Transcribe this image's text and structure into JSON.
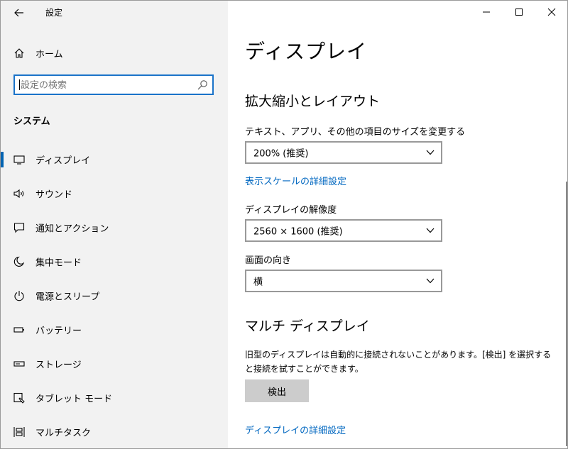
{
  "window": {
    "title": "設定"
  },
  "sidebar": {
    "home_label": "ホーム",
    "search": {
      "placeholder": "設定の検索",
      "value": ""
    },
    "section_title": "システム",
    "items": [
      {
        "label": "ディスプレイ",
        "icon": "monitor-icon",
        "selected": true
      },
      {
        "label": "サウンド",
        "icon": "speaker-icon"
      },
      {
        "label": "通知とアクション",
        "icon": "message-icon"
      },
      {
        "label": "集中モード",
        "icon": "moon-icon"
      },
      {
        "label": "電源とスリープ",
        "icon": "power-icon"
      },
      {
        "label": "バッテリー",
        "icon": "battery-icon"
      },
      {
        "label": "ストレージ",
        "icon": "storage-icon"
      },
      {
        "label": "タブレット モード",
        "icon": "tablet-icon"
      },
      {
        "label": "マルチタスク",
        "icon": "multitask-icon"
      }
    ]
  },
  "main": {
    "title": "ディスプレイ",
    "scale_section": {
      "heading": "拡大縮小とレイアウト",
      "text_size_label": "テキスト、アプリ、その他の項目のサイズを変更する",
      "text_size_value": "200% (推奨)",
      "advanced_scale_link": "表示スケールの詳細設定",
      "resolution_label": "ディスプレイの解像度",
      "resolution_value": "2560 × 1600 (推奨)",
      "orientation_label": "画面の向き",
      "orientation_value": "横"
    },
    "multi_section": {
      "heading": "マルチ ディスプレイ",
      "description_line1": "旧型のディスプレイは自動的に接続されないことがあります。[検出] を選択する",
      "description_line2": "と接続を試すことができます。",
      "detect_button": "検出",
      "advanced_display_link": "ディスプレイの詳細設定"
    }
  },
  "colors": {
    "accent": "#0063b1",
    "link": "#0067c0",
    "sidebar_bg": "#f2f2f2"
  }
}
